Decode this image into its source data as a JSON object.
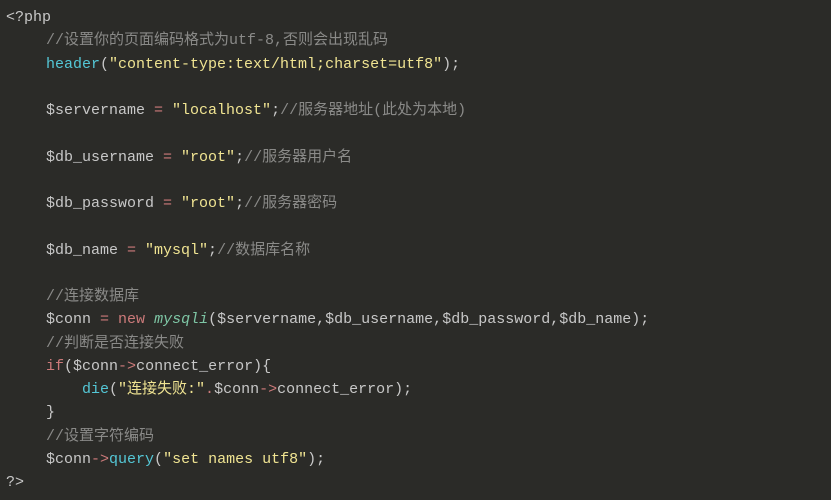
{
  "php_open": "<?php",
  "php_close": "?>",
  "comments": {
    "c1": "//设置你的页面编码格式为utf-8,否则会出现乱码",
    "c2": "//服务器地址(此处为本地)",
    "c3": "//服务器用户名",
    "c4": "//服务器密码",
    "c5": "//数据库名称",
    "c6": "//连接数据库",
    "c7": "//判断是否连接失败",
    "c8": "//设置字符编码"
  },
  "funcs": {
    "header": "header",
    "mysqli": "mysqli",
    "die": "die",
    "query": "query"
  },
  "keywords": {
    "new": "new",
    "if": "if"
  },
  "vars": {
    "servername": "$servername",
    "db_username": "$db_username",
    "db_password": "$db_password",
    "db_name": "$db_name",
    "conn": "$conn"
  },
  "props": {
    "connect_error": "connect_error"
  },
  "strings": {
    "header_val": "\"content-type:text/html;charset=utf8\"",
    "localhost": "\"localhost\"",
    "root": "\"root\"",
    "mysql": "\"mysql\"",
    "fail_prefix": "\"连接失败:\"",
    "set_names": "\"set names utf8\""
  },
  "punct": {
    "eq": " = ",
    "semi": ";",
    "lpar": "(",
    "rpar": ")",
    "lbrace": "{",
    "rbrace": "}",
    "comma": ",",
    "arrow": "->",
    "dot": "."
  }
}
